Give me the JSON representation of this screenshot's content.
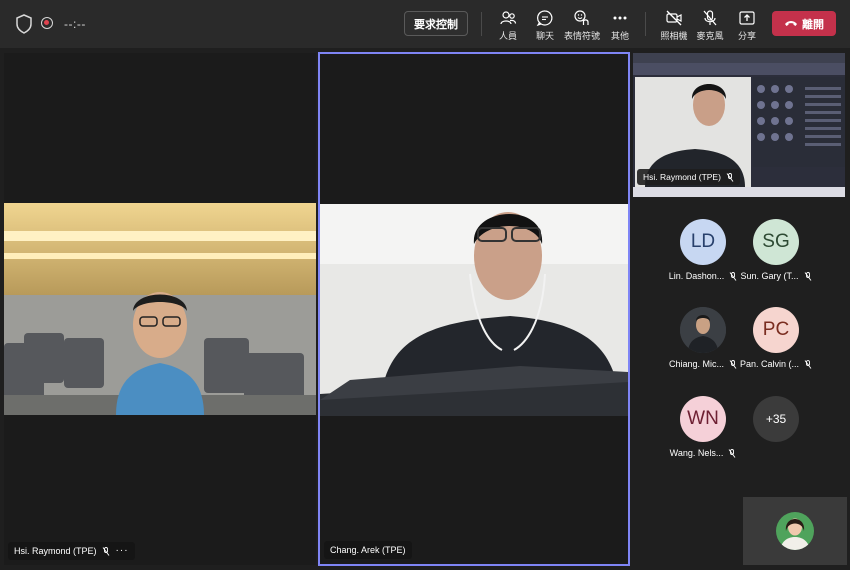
{
  "topbar": {
    "timer": "--:--",
    "request_control": "要求控制",
    "tools": [
      {
        "id": "people",
        "label": "人員",
        "icon": "people-icon"
      },
      {
        "id": "chat",
        "label": "聊天",
        "icon": "chat-icon"
      },
      {
        "id": "reactions",
        "label": "表情符號",
        "icon": "reactions-icon"
      },
      {
        "id": "more",
        "label": "其他",
        "icon": "more-dots-icon"
      },
      {
        "id": "camera",
        "label": "照相機",
        "icon": "camera-off-icon"
      },
      {
        "id": "mic",
        "label": "麥克風",
        "icon": "mic-off-icon"
      },
      {
        "id": "share",
        "label": "分享",
        "icon": "share-tray-icon"
      }
    ],
    "leave": "離開"
  },
  "video_tiles": [
    {
      "name": "Hsi. Raymond (TPE)",
      "has_more": "···"
    },
    {
      "name": "Chang. Arek (TPE)"
    }
  ],
  "share_preview": {
    "presenter": "Hsi. Raymond (TPE)"
  },
  "participants": [
    {
      "initials": "LD",
      "name": "Lin. Dashon...",
      "bg": "#c7d7f2",
      "fg": "#28406c"
    },
    {
      "initials": "SG",
      "name": "Sun. Gary (T...",
      "bg": "#cfe6d5",
      "fg": "#2d4a33"
    },
    {
      "initials": "",
      "name": "Chiang. Mic...",
      "bg": "#3b3f44",
      "fg": "#ffffff"
    },
    {
      "initials": "PC",
      "name": "Pan. Calvin (...",
      "bg": "#f6d5cf",
      "fg": "#7a2d20"
    },
    {
      "initials": "WN",
      "name": "Wang. Nels...",
      "bg": "#f5d0d8",
      "fg": "#6e2033"
    },
    {
      "initials": "+35",
      "name": "",
      "bg": "#3b3b3b",
      "fg": "#ffffff"
    }
  ],
  "colors": {
    "accent": "#7f85f5",
    "leave": "#c4314b"
  }
}
